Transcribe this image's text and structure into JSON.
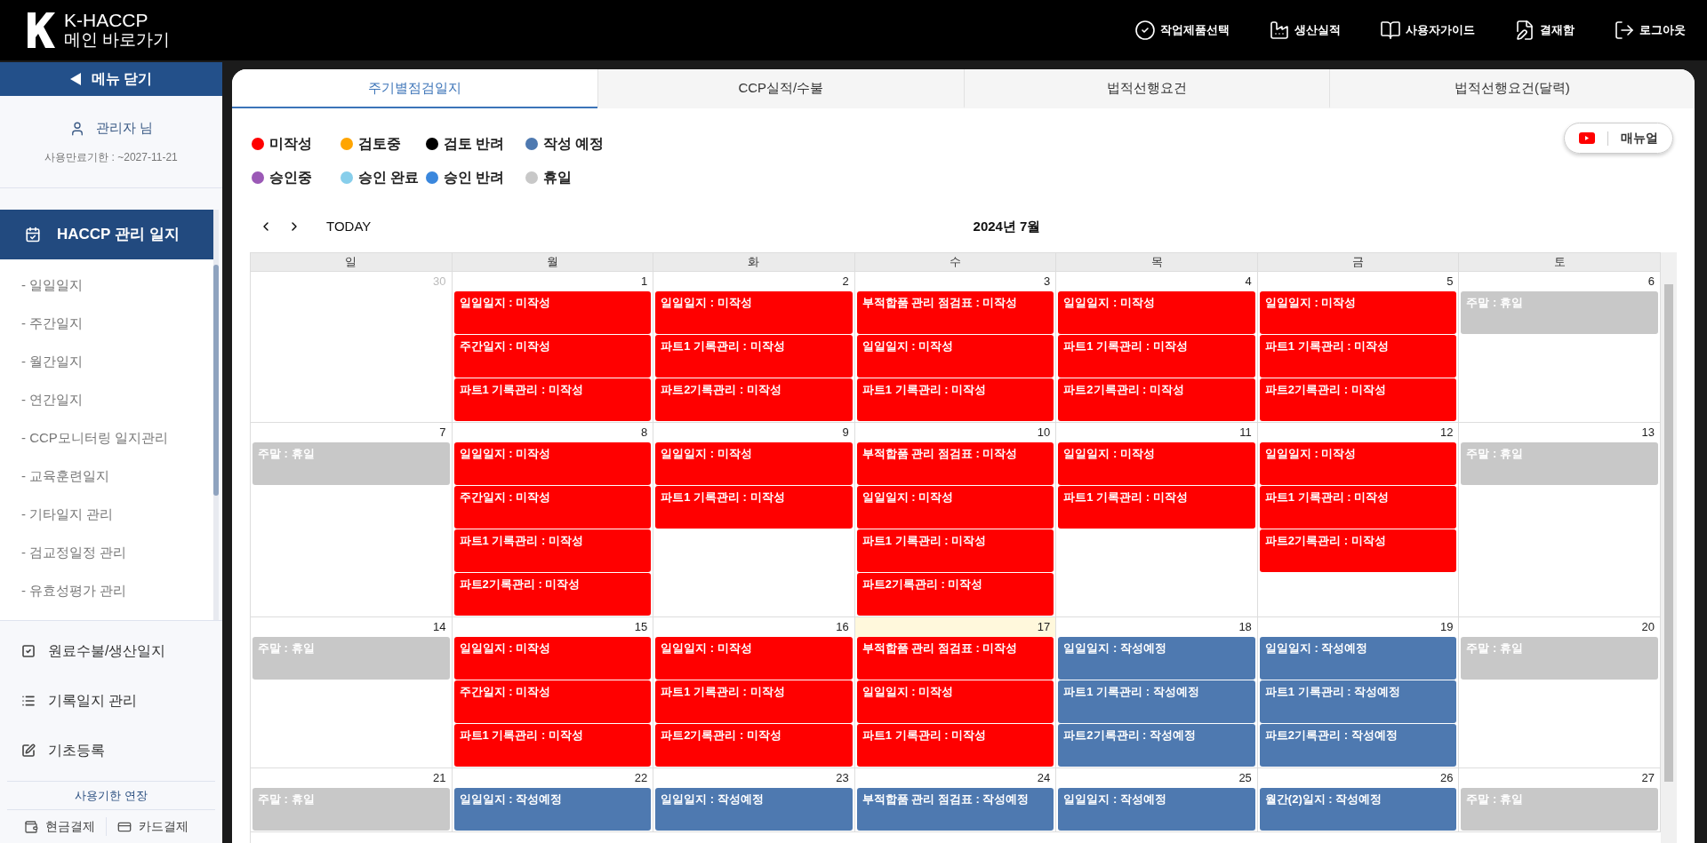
{
  "header": {
    "logo": "K-HACCP",
    "home_link": "메인 바로가기",
    "nav": [
      "작업제품선택",
      "생산실적",
      "사용자가이드",
      "결재함",
      "로그아웃"
    ]
  },
  "sidebar": {
    "close_button": "메뉴 닫기",
    "user": "관리자 님",
    "expiry": "사용만료기한 : ~2027-11-21",
    "section": {
      "label": "HACCP 관리 일지",
      "selected": true,
      "children": [
        "- 일일일지",
        "- 주간일지",
        "- 월간일지",
        "- 연간일지",
        "- CCP모니터링 일지관리",
        "- 교육훈련일지",
        "- 기타일지 관리",
        "- 검교정일정 관리",
        "- 유효성평가 관리"
      ]
    },
    "menu": [
      {
        "label": "원료수불/생산일지",
        "kind": "check"
      },
      {
        "label": "기록일지 관리",
        "kind": "list"
      },
      {
        "label": "기초등록",
        "kind": "edit"
      }
    ],
    "extend_title": "사용기한 연장",
    "payments": [
      {
        "label": "현금결제",
        "kind": "wallet"
      },
      {
        "label": "카드결제",
        "kind": "card"
      }
    ]
  },
  "tabs": [
    {
      "label": "주기별점검일지",
      "selected": true
    },
    {
      "label": "CCP실적/수불",
      "selected": false
    },
    {
      "label": "법적선행요건",
      "selected": false
    },
    {
      "label": "법적선행요건(달력)",
      "selected": false
    }
  ],
  "legend": [
    {
      "label": "미작성",
      "color": "#ff0000"
    },
    {
      "label": "검토중",
      "color": "#ffa500"
    },
    {
      "label": "검토 반려",
      "color": "#000000"
    },
    {
      "label": "작성 예정",
      "color": "#4e79b0"
    },
    {
      "label": "승인중",
      "color": "#9b59b6"
    },
    {
      "label": "승인 완료",
      "color": "#87ceeb"
    },
    {
      "label": "승인 반려",
      "color": "#3a87dd"
    },
    {
      "label": "휴일",
      "color": "#c8c8c8"
    }
  ],
  "manual_button": "매뉴얼",
  "calendar": {
    "today_button": "TODAY",
    "title": "2024년 7월",
    "weekdays": [
      "일",
      "월",
      "화",
      "수",
      "목",
      "금",
      "토"
    ],
    "weeks": [
      {
        "days": [
          {
            "date": "30",
            "other_month": true,
            "today": false
          },
          {
            "date": "1",
            "other_month": false,
            "today": false,
            "events": [
              {
                "text": "일일일지 : 미작성",
                "color": "#ff0000"
              },
              {
                "text": "주간일지 : 미작성",
                "color": "#ff0000"
              },
              {
                "text": "파트1 기록관리 : 미작성",
                "color": "#ff0000"
              }
            ]
          },
          {
            "date": "2",
            "other_month": false,
            "today": false,
            "events": [
              {
                "text": "일일일지 : 미작성",
                "color": "#ff0000"
              },
              {
                "text": "파트1 기록관리 : 미작성",
                "color": "#ff0000"
              },
              {
                "text": "파트2기록관리 : 미작성",
                "color": "#ff0000"
              }
            ]
          },
          {
            "date": "3",
            "other_month": false,
            "today": false,
            "events": [
              {
                "text": "부적합품 관리 점검표 : 미작성",
                "color": "#ff0000"
              },
              {
                "text": "일일일지 : 미작성",
                "color": "#ff0000"
              },
              {
                "text": "파트1 기록관리 : 미작성",
                "color": "#ff0000"
              }
            ]
          },
          {
            "date": "4",
            "other_month": false,
            "today": false,
            "events": [
              {
                "text": "일일일지 : 미작성",
                "color": "#ff0000"
              },
              {
                "text": "파트1 기록관리 : 미작성",
                "color": "#ff0000"
              },
              {
                "text": "파트2기록관리 : 미작성",
                "color": "#ff0000"
              }
            ]
          },
          {
            "date": "5",
            "other_month": false,
            "today": false,
            "events": [
              {
                "text": "일일일지 : 미작성",
                "color": "#ff0000"
              },
              {
                "text": "파트1 기록관리 : 미작성",
                "color": "#ff0000"
              },
              {
                "text": "파트2기록관리 : 미작성",
                "color": "#ff0000"
              }
            ]
          },
          {
            "date": "6",
            "other_month": false,
            "today": false,
            "events": [
              {
                "text": "주말 : 휴일",
                "color": "#c8c8c8"
              }
            ]
          }
        ]
      },
      {
        "days": [
          {
            "date": "7",
            "other_month": false,
            "today": false,
            "events": [
              {
                "text": "주말 : 휴일",
                "color": "#c8c8c8"
              }
            ]
          },
          {
            "date": "8",
            "other_month": false,
            "today": false,
            "events": [
              {
                "text": "일일일지 : 미작성",
                "color": "#ff0000"
              },
              {
                "text": "주간일지 : 미작성",
                "color": "#ff0000"
              },
              {
                "text": "파트1 기록관리 : 미작성",
                "color": "#ff0000"
              },
              {
                "text": "파트2기록관리 : 미작성",
                "color": "#ff0000"
              }
            ]
          },
          {
            "date": "9",
            "other_month": false,
            "today": false,
            "events": [
              {
                "text": "일일일지 : 미작성",
                "color": "#ff0000"
              },
              {
                "text": "파트1 기록관리 : 미작성",
                "color": "#ff0000"
              }
            ]
          },
          {
            "date": "10",
            "other_month": false,
            "today": false,
            "events": [
              {
                "text": "부적합품 관리 점검표 : 미작성",
                "color": "#ff0000"
              },
              {
                "text": "일일일지 : 미작성",
                "color": "#ff0000"
              },
              {
                "text": "파트1 기록관리 : 미작성",
                "color": "#ff0000"
              },
              {
                "text": "파트2기록관리 : 미작성",
                "color": "#ff0000"
              }
            ]
          },
          {
            "date": "11",
            "other_month": false,
            "today": false,
            "events": [
              {
                "text": "일일일지 : 미작성",
                "color": "#ff0000"
              },
              {
                "text": "파트1 기록관리 : 미작성",
                "color": "#ff0000"
              }
            ]
          },
          {
            "date": "12",
            "other_month": false,
            "today": false,
            "events": [
              {
                "text": "일일일지 : 미작성",
                "color": "#ff0000"
              },
              {
                "text": "파트1 기록관리 : 미작성",
                "color": "#ff0000"
              },
              {
                "text": "파트2기록관리 : 미작성",
                "color": "#ff0000"
              }
            ]
          },
          {
            "date": "13",
            "other_month": false,
            "today": false,
            "events": [
              {
                "text": "주말 : 휴일",
                "color": "#c8c8c8"
              }
            ]
          }
        ]
      },
      {
        "days": [
          {
            "date": "14",
            "other_month": false,
            "today": false,
            "events": [
              {
                "text": "주말 : 휴일",
                "color": "#c8c8c8"
              }
            ]
          },
          {
            "date": "15",
            "other_month": false,
            "today": false,
            "events": [
              {
                "text": "일일일지 : 미작성",
                "color": "#ff0000"
              },
              {
                "text": "주간일지 : 미작성",
                "color": "#ff0000"
              },
              {
                "text": "파트1 기록관리 : 미작성",
                "color": "#ff0000"
              }
            ]
          },
          {
            "date": "16",
            "other_month": false,
            "today": false,
            "events": [
              {
                "text": "일일일지 : 미작성",
                "color": "#ff0000"
              },
              {
                "text": "파트1 기록관리 : 미작성",
                "color": "#ff0000"
              },
              {
                "text": "파트2기록관리 : 미작성",
                "color": "#ff0000"
              }
            ]
          },
          {
            "date": "17",
            "other_month": false,
            "today": true,
            "events": [
              {
                "text": "부적합품 관리 점검표 : 미작성",
                "color": "#ff0000"
              },
              {
                "text": "일일일지 : 미작성",
                "color": "#ff0000"
              },
              {
                "text": "파트1 기록관리 : 미작성",
                "color": "#ff0000"
              }
            ]
          },
          {
            "date": "18",
            "other_month": false,
            "today": false,
            "events": [
              {
                "text": "일일일지 : 작성예정",
                "color": "#4e79b0"
              },
              {
                "text": "파트1 기록관리 : 작성예정",
                "color": "#4e79b0"
              },
              {
                "text": "파트2기록관리 : 작성예정",
                "color": "#4e79b0"
              }
            ]
          },
          {
            "date": "19",
            "other_month": false,
            "today": false,
            "events": [
              {
                "text": "일일일지 : 작성예정",
                "color": "#4e79b0"
              },
              {
                "text": "파트1 기록관리 : 작성예정",
                "color": "#4e79b0"
              },
              {
                "text": "파트2기록관리 : 작성예정",
                "color": "#4e79b0"
              }
            ]
          },
          {
            "date": "20",
            "other_month": false,
            "today": false,
            "events": [
              {
                "text": "주말 : 휴일",
                "color": "#c8c8c8"
              }
            ]
          }
        ]
      },
      {
        "days": [
          {
            "date": "21",
            "other_month": false,
            "today": false,
            "events": [
              {
                "text": "주말 : 휴일",
                "color": "#c8c8c8"
              }
            ]
          },
          {
            "date": "22",
            "other_month": false,
            "today": false,
            "events": [
              {
                "text": "일일일지 : 작성예정",
                "color": "#4e79b0"
              }
            ]
          },
          {
            "date": "23",
            "other_month": false,
            "today": false,
            "events": [
              {
                "text": "일일일지 : 작성예정",
                "color": "#4e79b0"
              }
            ]
          },
          {
            "date": "24",
            "other_month": false,
            "today": false,
            "events": [
              {
                "text": "부적합품 관리 점검표 : 작성예정",
                "color": "#4e79b0"
              }
            ]
          },
          {
            "date": "25",
            "other_month": false,
            "today": false,
            "events": [
              {
                "text": "일일일지 : 작성예정",
                "color": "#4e79b0"
              }
            ]
          },
          {
            "date": "26",
            "other_month": false,
            "today": false,
            "events": [
              {
                "text": "월간(2)일지 : 작성예정",
                "color": "#4e79b0"
              }
            ]
          },
          {
            "date": "27",
            "other_month": false,
            "today": false,
            "events": [
              {
                "text": "주말 : 휴일",
                "color": "#c8c8c8"
              }
            ]
          }
        ]
      }
    ]
  }
}
